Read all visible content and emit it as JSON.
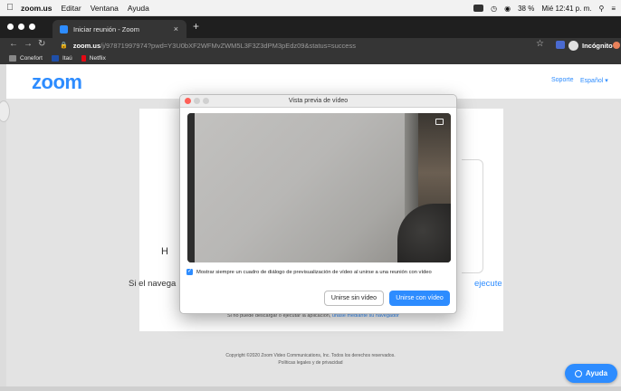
{
  "menubar": {
    "app": "zoom.us",
    "items": [
      "Editar",
      "Ventana",
      "Ayuda"
    ],
    "battery": "38 %",
    "clock": "Mié 12:41 p. m."
  },
  "browser": {
    "tab_title": "Iniciar reunión - Zoom",
    "url_host": "zoom.us",
    "url_path": "/j/97871997974?pwd=Y3U0bXF2WFMvZWM5L3F3Z3dPM3pEdz09&status=success",
    "incognito_label": "Incógnito",
    "bookmarks": [
      "Conefort",
      "Itaú",
      "Netflix"
    ]
  },
  "zoom_header": {
    "logo": "zoom",
    "support": "Soporte",
    "language": "Español ▾"
  },
  "page": {
    "h_letter": "H",
    "launch_left": "Si el navega",
    "launch_right": "ejecute",
    "foot_text": "Si no puede descargar o ejecutar la aplicación,",
    "foot_link": "únase mediante su navegador",
    "copyright_line1": "Copyright ©2020 Zoom Video Communications, Inc. Todos los derechos reservados.",
    "copyright_line2": "Políticas legales y de privacidad",
    "help_button": "Ayuda"
  },
  "dialog": {
    "title": "Vista previa de vídeo",
    "checkbox_label": "Mostrar siempre un cuadro de diálogo de previsualización de vídeo al unirse a una reunión con vídeo",
    "checkbox_checked": true,
    "btn_no_video": "Unirse sin vídeo",
    "btn_video": "Unirse con vídeo"
  },
  "colors": {
    "accent": "#2d8cff"
  }
}
